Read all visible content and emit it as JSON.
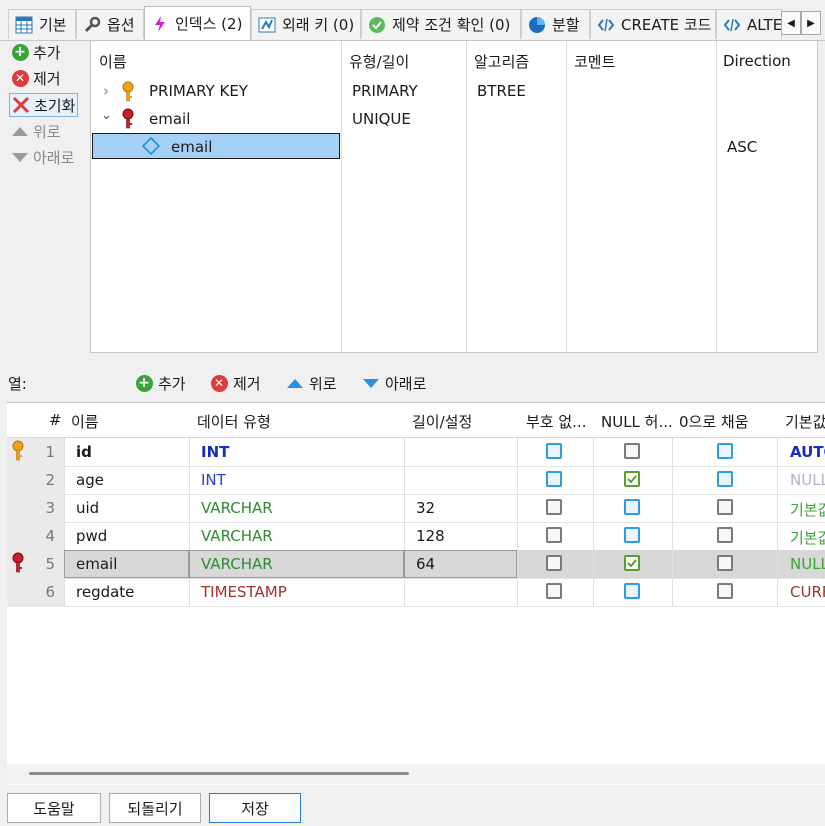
{
  "tabs": [
    {
      "label": "기본",
      "icon": "table-icon"
    },
    {
      "label": "옵션",
      "icon": "wrench-icon"
    },
    {
      "label": "인덱스 (2)",
      "icon": "lightning-icon"
    },
    {
      "label": "외래 키 (0)",
      "icon": "foreign-key-icon"
    },
    {
      "label": "제약 조건 확인 (0)",
      "icon": "check-icon"
    },
    {
      "label": "분할",
      "icon": "pie-icon"
    },
    {
      "label": "CREATE 코드",
      "icon": "code-icon"
    },
    {
      "label": "ALTER",
      "icon": "code-icon"
    }
  ],
  "index_actions": {
    "add": "추가",
    "remove": "제거",
    "reset": "초기화",
    "up": "위로",
    "down": "아래로"
  },
  "index_grid": {
    "headers": [
      "이름",
      "유형/길이",
      "알고리즘",
      "코멘트",
      "Direction"
    ],
    "rows": [
      {
        "name": "PRIMARY KEY",
        "type": "PRIMARY",
        "algorithm": "BTREE",
        "direction": ""
      },
      {
        "name": "email",
        "type": "UNIQUE",
        "algorithm": "",
        "direction": ""
      },
      {
        "name": "email",
        "type": "",
        "algorithm": "",
        "direction": "ASC"
      }
    ]
  },
  "columns_bar": {
    "label": "열:",
    "add": "추가",
    "remove": "제거",
    "up": "위로",
    "down": "아래로"
  },
  "column_grid": {
    "headers": [
      "#",
      "이름",
      "데이터 유형",
      "길이/설정",
      "부호 없...",
      "NULL 허...",
      "0으로 채움",
      "기본값"
    ],
    "rows": [
      {
        "num": "1",
        "name": "id",
        "type": "INT",
        "length": "",
        "unsigned": "blue",
        "nullable": "gray",
        "zerofill": "blue",
        "default": "AUTO",
        "key": "primary",
        "type_color": "#1a2bbf",
        "default_color": "#1a2bbf",
        "bold": true
      },
      {
        "num": "2",
        "name": "age",
        "type": "INT",
        "length": "",
        "unsigned": "blue",
        "nullable": "checked",
        "zerofill": "blue",
        "default": "NULL",
        "key": "",
        "type_color": "#2a3fd6",
        "default_color": "#b0b0c8",
        "bold": false
      },
      {
        "num": "3",
        "name": "uid",
        "type": "VARCHAR",
        "length": "32",
        "unsigned": "gray",
        "nullable": "blue",
        "zerofill": "gray",
        "default": "기본값",
        "key": "",
        "type_color": "#2e8b2e",
        "default_color": "#3aa33a",
        "bold": false
      },
      {
        "num": "4",
        "name": "pwd",
        "type": "VARCHAR",
        "length": "128",
        "unsigned": "gray",
        "nullable": "blue",
        "zerofill": "gray",
        "default": "기본값",
        "key": "",
        "type_color": "#2e8b2e",
        "default_color": "#3aa33a",
        "bold": false
      },
      {
        "num": "5",
        "name": "email",
        "type": "VARCHAR",
        "length": "64",
        "unsigned": "gray",
        "nullable": "checked",
        "zerofill": "gray",
        "default": "NULL",
        "key": "unique",
        "type_color": "#2e8b2e",
        "default_color": "#3aa33a",
        "bold": false
      },
      {
        "num": "6",
        "name": "regdate",
        "type": "TIMESTAMP",
        "length": "",
        "unsigned": "gray",
        "nullable": "blue",
        "zerofill": "gray",
        "default": "CURR",
        "key": "",
        "type_color": "#a0322a",
        "default_color": "#a0322a",
        "bold": false
      }
    ]
  },
  "footer": {
    "help": "도움말",
    "revert": "되돌리기",
    "save": "저장"
  }
}
